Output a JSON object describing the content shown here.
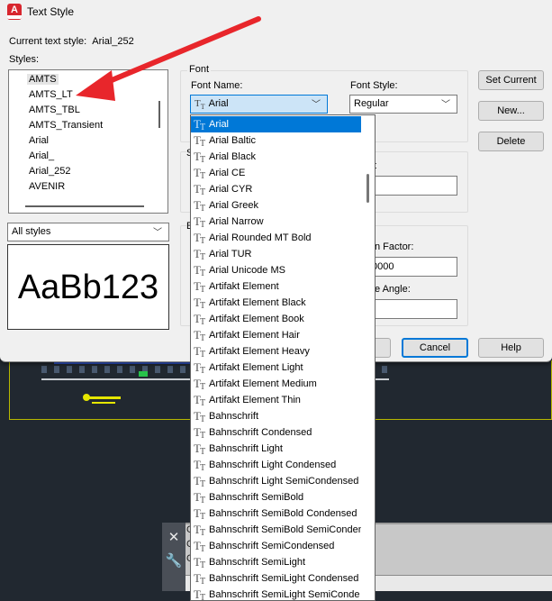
{
  "dialog": {
    "title": "Text Style",
    "current_style_label": "Current text style:",
    "current_style_value": "Arial_252",
    "styles_label": "Styles:",
    "styles_list": [
      "AMTS",
      "AMTS_LT",
      "AMTS_TBL",
      "AMTS_Transient",
      "Arial",
      "Arial_",
      "Arial_252",
      "AVENIR"
    ],
    "filter_value": "All styles",
    "preview_text": "AaBb123"
  },
  "font": {
    "group_label": "Font",
    "font_name_label": "Font Name:",
    "font_name_value": "Arial",
    "font_style_label": "Font Style:",
    "font_style_value": "Regular",
    "s_label": "S",
    "t_label": "t",
    "e_label": "E",
    "width_factor_label": "n Factor:",
    "width_factor_value": "0000",
    "oblique_label": "e Angle:"
  },
  "buttons": {
    "set_current": "Set Current",
    "new": "New...",
    "delete": "Delete",
    "cancel": "Cancel",
    "help": "Help"
  },
  "font_list": [
    "Arial",
    "Arial Baltic",
    "Arial Black",
    "Arial CE",
    "Arial CYR",
    "Arial Greek",
    "Arial Narrow",
    "Arial Rounded MT Bold",
    "Arial TUR",
    "Arial Unicode MS",
    "Artifakt Element",
    "Artifakt Element Black",
    "Artifakt Element Book",
    "Artifakt Element Hair",
    "Artifakt Element Heavy",
    "Artifakt Element Light",
    "Artifakt Element Medium",
    "Artifakt Element Thin",
    "Bahnschrift",
    "Bahnschrift Condensed",
    "Bahnschrift Light",
    "Bahnschrift Light Condensed",
    "Bahnschrift Light SemiCondensed",
    "Bahnschrift SemiBold",
    "Bahnschrift SemiBold Condensed",
    "Bahnschrift SemiBold SemiConden",
    "Bahnschrift SemiCondensed",
    "Bahnschrift SemiLight",
    "Bahnschrift SemiLight Condensed",
    "Bahnschrift SemiLight SemiConde"
  ],
  "font_list_highlight": "Arial",
  "command_line": {
    "letters": [
      "C",
      "C",
      "C"
    ]
  },
  "annotation": {
    "arrow_color": "#e8262b"
  },
  "colors": {
    "accent": "#0078d7",
    "cad_background": "#212830"
  }
}
